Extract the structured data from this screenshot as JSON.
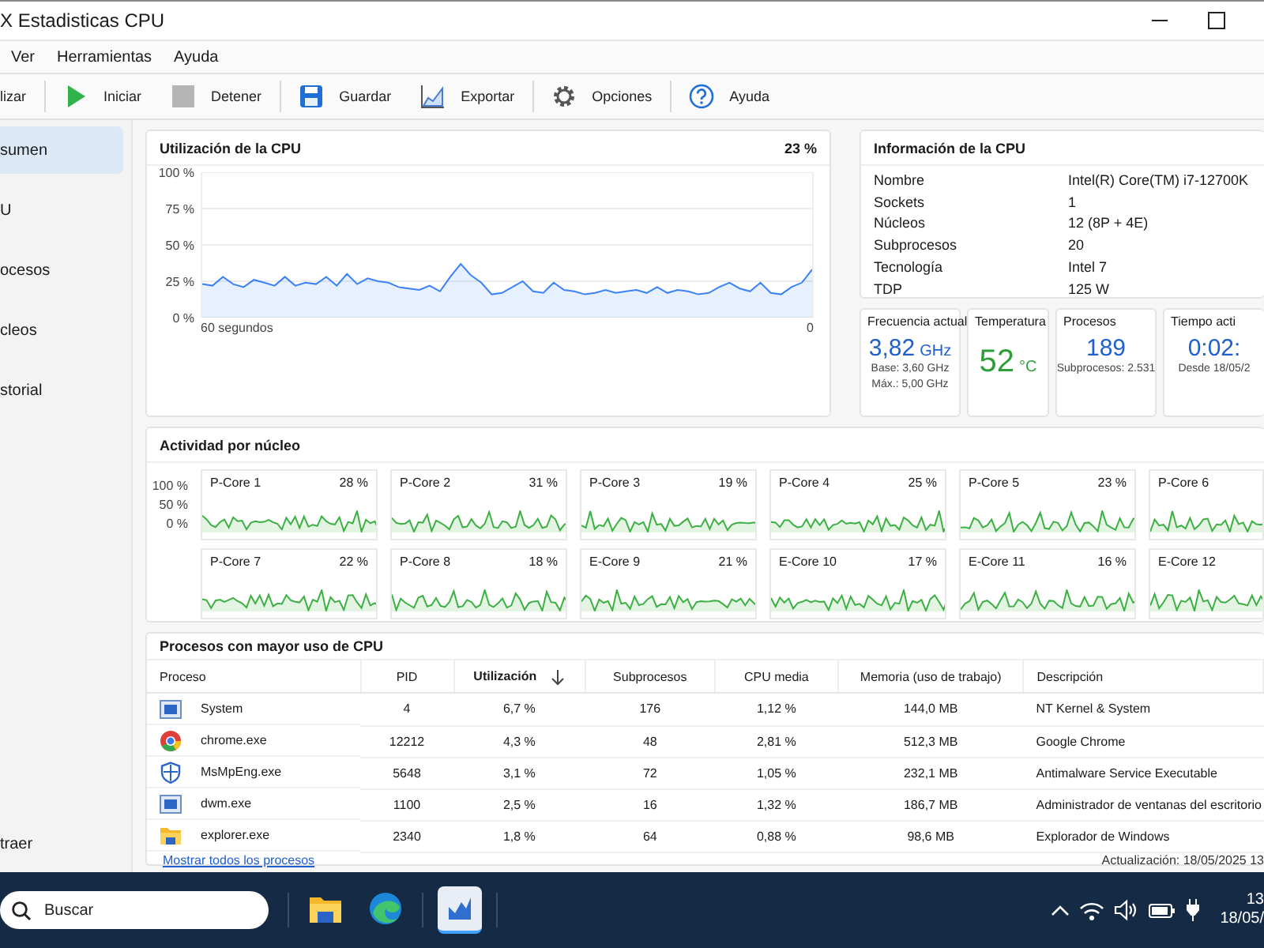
{
  "window": {
    "title": "X Estadisticas CPU"
  },
  "menu": [
    {
      "label": "Ver"
    },
    {
      "label": "Herramientas"
    },
    {
      "label": "Ayuda"
    }
  ],
  "toolbar": [
    [
      {
        "label": "lizar",
        "kind": "none"
      }
    ],
    [
      {
        "label": "Iniciar",
        "kind": "play"
      },
      {
        "label": "Detener",
        "kind": "stop"
      }
    ],
    [
      {
        "label": "Guardar",
        "kind": "save"
      },
      {
        "label": "Exportar",
        "kind": "export"
      }
    ],
    [
      {
        "label": "Opciones",
        "kind": "gear"
      }
    ],
    [
      {
        "label": "Ayuda",
        "kind": "help"
      }
    ]
  ],
  "sidebar": {
    "items": [
      {
        "label": "sumen",
        "selected": true
      },
      {
        "label": "U",
        "selected": false
      },
      {
        "label": "ocesos",
        "selected": false
      },
      {
        "label": "cleos",
        "selected": false
      },
      {
        "label": "storial",
        "selected": false
      }
    ],
    "footer": "traer"
  },
  "cpu_usage": {
    "title": "Utilización de la CPU",
    "reading": "23 %",
    "axis_start": "60 segundos",
    "axis_end": "0",
    "chart_data": {
      "type": "area",
      "grid": true,
      "ylim": [
        0,
        100
      ],
      "yticks": [
        {
          "value": 100,
          "label": "100 %"
        },
        {
          "value": 75,
          "label": "75 %"
        },
        {
          "value": 50,
          "label": "50 %"
        },
        {
          "value": 25,
          "label": "25 %"
        },
        {
          "value": 0,
          "label": "0 %"
        }
      ],
      "series": [
        {
          "color": "#3b82f6",
          "values": [
            23,
            22,
            28,
            23,
            21,
            26,
            24,
            22,
            28,
            22,
            24,
            23,
            28,
            22,
            30,
            23,
            27,
            25,
            24,
            21,
            20,
            19,
            22,
            18,
            28,
            37,
            29,
            24,
            16,
            17,
            21,
            25,
            18,
            17,
            24,
            19,
            18,
            16,
            17,
            19,
            17,
            18,
            19,
            17,
            21,
            17,
            19,
            18,
            16,
            17,
            21,
            24,
            20,
            18,
            24,
            17,
            16,
            21,
            24,
            33
          ]
        }
      ]
    }
  },
  "cpu_info": {
    "title": "Información de la CPU",
    "rows": [
      {
        "label": "Nombre",
        "value": "Intel(R) Core(TM) i7-12700K"
      },
      {
        "label": "Sockets",
        "value": "1"
      },
      {
        "label": "Núcleos",
        "value": "12 (8P + 4E)"
      },
      {
        "label": "Subprocesos",
        "value": "20"
      },
      {
        "label": "Tecnología",
        "value": "Intel 7"
      },
      {
        "label": "TDP",
        "value": "125 W"
      }
    ]
  },
  "stat_cards": [
    {
      "title": "Frecuencia actual",
      "value": "3,82",
      "unit": "GHz",
      "color": "#1f5fd0",
      "lines": [
        "Base: 3,60 GHz",
        "Máx.: 5,00 GHz"
      ]
    },
    {
      "title": "Temperatura",
      "value": "52",
      "unit": "°C",
      "color": "#2e9e3a"
    },
    {
      "title": "Procesos",
      "value": "189",
      "color": "#1f5fd0",
      "lines": [
        "Subprocesos: 2.531"
      ]
    },
    {
      "title": "Tiempo acti",
      "value": "0:02:",
      "color": "#1f5fd0",
      "lines": [
        "Desde 18/05/2"
      ]
    }
  ],
  "cores": {
    "title": "Actividad por núcleo",
    "axis": [
      "100 %",
      "50 %",
      "0 %"
    ],
    "items": [
      {
        "name": "P-Core 1",
        "reading": "28 %"
      },
      {
        "name": "P-Core 2",
        "reading": "31 %"
      },
      {
        "name": "P-Core 3",
        "reading": "19 %"
      },
      {
        "name": "P-Core 4",
        "reading": "25 %"
      },
      {
        "name": "P-Core 5",
        "reading": "23 %"
      },
      {
        "name": "P-Core 6"
      },
      {
        "name": "P-Core 7",
        "reading": "22 %"
      },
      {
        "name": "P-Core 8",
        "reading": "18 %"
      },
      {
        "name": "E-Core 9",
        "reading": "21 %"
      },
      {
        "name": "E-Core 10",
        "reading": "17 %"
      },
      {
        "name": "E-Core 11",
        "reading": "16 %"
      },
      {
        "name": "E-Core 12"
      }
    ]
  },
  "processes": {
    "title": "Procesos con mayor uso de CPU",
    "columns": [
      {
        "label": "Proceso",
        "sorted": false
      },
      {
        "label": "PID",
        "sorted": false
      },
      {
        "label": "Utilización",
        "sorted": true
      },
      {
        "label": "Subprocesos",
        "sorted": false
      },
      {
        "label": "CPU media",
        "sorted": false
      },
      {
        "label": "Memoria (uso de trabajo)",
        "sorted": false
      },
      {
        "label": "Descripción",
        "sorted": false
      }
    ],
    "rows": [
      {
        "kind": "system",
        "cells": [
          "System",
          "4",
          "6,7 %",
          "176",
          "1,12 %",
          "144,0 MB",
          "NT Kernel & System"
        ]
      },
      {
        "kind": "chrome",
        "cells": [
          "chrome.exe",
          "12212",
          "4,3 %",
          "48",
          "2,81 %",
          "512,3 MB",
          "Google Chrome"
        ]
      },
      {
        "kind": "shield",
        "cells": [
          "MsMpEng.exe",
          "5648",
          "3,1 %",
          "72",
          "1,05 %",
          "232,1 MB",
          "Antimalware Service Executable"
        ]
      },
      {
        "kind": "system",
        "cells": [
          "dwm.exe",
          "1100",
          "2,5 %",
          "16",
          "1,32 %",
          "186,7 MB",
          "Administrador de ventanas del escritorio"
        ]
      },
      {
        "kind": "folder",
        "cells": [
          "explorer.exe",
          "2340",
          "1,8 %",
          "64",
          "0,88 %",
          "98,6 MB",
          "Explorador de Windows"
        ]
      }
    ],
    "link": "Mostrar todos los procesos",
    "updated": "Actualización: 18/05/2025 13"
  },
  "taskbar": {
    "search": {
      "placeholder": "Buscar"
    },
    "apps": [
      {
        "kind": "folder",
        "selected": false
      },
      {
        "kind": "browser",
        "selected": false
      },
      {
        "kind": "monitor",
        "selected": true
      }
    ],
    "time": "13",
    "date": "18/05/"
  }
}
